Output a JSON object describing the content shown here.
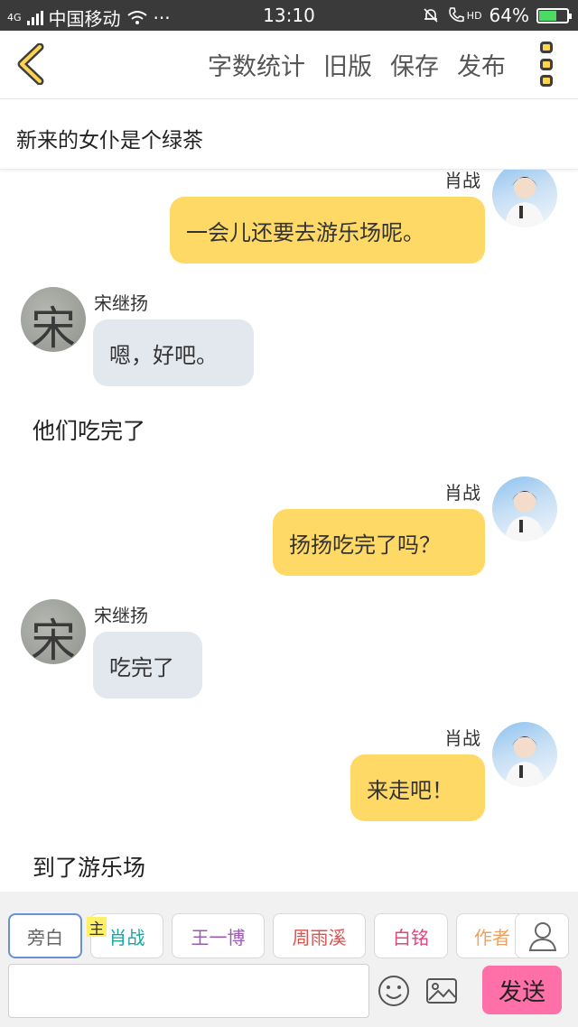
{
  "status_bar": {
    "network_type": "4G",
    "carrier": "中国移动",
    "more_indicator": "···",
    "time": "13:10",
    "hd_label": "HD",
    "battery_percent": "64%",
    "battery_level": 0.64
  },
  "header": {
    "actions": [
      "字数统计",
      "旧版",
      "保存",
      "发布"
    ],
    "icons": {
      "back": "back-chevron-icon",
      "menu": "more-menu-icon"
    },
    "accent_color": "#ffd54f"
  },
  "story": {
    "title": "新来的女仆是个绿茶"
  },
  "messages": [
    {
      "type": "speech",
      "speaker": "肖战",
      "side": "right",
      "text": "一会儿还要去游乐场呢。"
    },
    {
      "type": "speech",
      "speaker": "宋继扬",
      "side": "left",
      "text": "嗯，好吧。"
    },
    {
      "type": "narration",
      "text": "他们吃完了"
    },
    {
      "type": "speech",
      "speaker": "肖战",
      "side": "right",
      "text": "扬扬吃完了吗？"
    },
    {
      "type": "speech",
      "speaker": "宋继扬",
      "side": "left",
      "text": "吃完了"
    },
    {
      "type": "speech",
      "speaker": "肖战",
      "side": "right",
      "text": "来走吧！"
    },
    {
      "type": "narration",
      "text": "到了游乐场"
    }
  ],
  "avatar_glyph_song": "宋",
  "characters": [
    {
      "label": "旁白",
      "color": "#666666",
      "selected": true
    },
    {
      "label": "肖战",
      "color": "#1aa3a3",
      "main_tag": "主"
    },
    {
      "label": "王一博",
      "color": "#9b59b6"
    },
    {
      "label": "周雨溪",
      "color": "#d9534f"
    },
    {
      "label": "白铭",
      "color": "#e0457b"
    },
    {
      "label": "作者",
      "color": "#f0a05a"
    }
  ],
  "composer": {
    "input_value": "",
    "send_label": "发送",
    "send_color": "#ff6fa8",
    "icons": [
      "emoji-icon",
      "image-icon",
      "person-icon"
    ]
  },
  "colors": {
    "my_bubble": "#ffd966",
    "other_bubble": "#e3e8ee"
  }
}
